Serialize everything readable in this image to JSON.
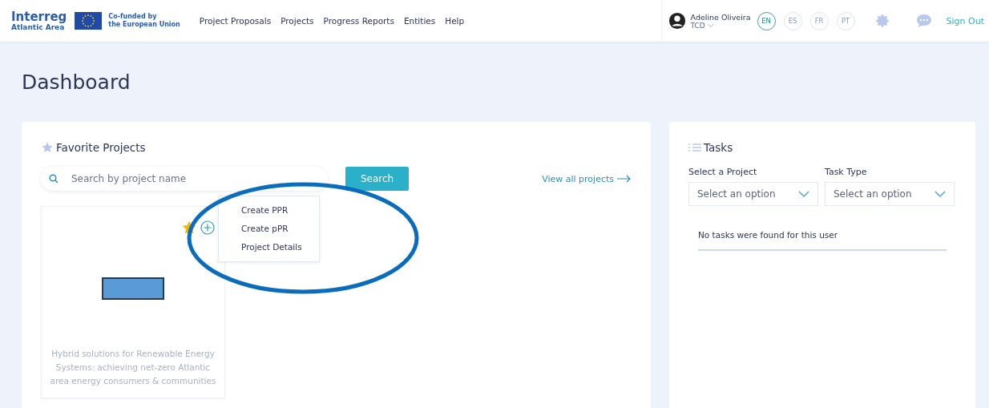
{
  "header": {
    "logo": {
      "line1": "Interreg",
      "line2": "Atlantic Area"
    },
    "eu": {
      "line1": "Co-funded by",
      "line2": "the European Union"
    },
    "nav": [
      {
        "label": "Project Proposals"
      },
      {
        "label": "Projects"
      },
      {
        "label": "Progress Reports"
      },
      {
        "label": "Entities"
      },
      {
        "label": "Help"
      }
    ],
    "user": {
      "name": "Adeline Oliveira",
      "org": "TCD"
    },
    "languages": [
      {
        "code": "EN",
        "selected": true
      },
      {
        "code": "ES",
        "selected": false
      },
      {
        "code": "FR",
        "selected": false
      },
      {
        "code": "PT",
        "selected": false
      }
    ],
    "sign_out": "Sign Out"
  },
  "page_title": "Dashboard",
  "favorites": {
    "title": "Favorite Projects",
    "search": {
      "placeholder": "Search by project name",
      "button": "Search"
    },
    "view_all": "View all projects",
    "projects": [
      {
        "title": "Hybrid solutions for Renewable Energy Systems: achieving net-zero Atlantic area energy consumers & communities",
        "favorite": true,
        "menu": [
          "Create PPR",
          "Create pPR",
          "Project Details"
        ]
      }
    ]
  },
  "tasks": {
    "title": "Tasks",
    "filters": [
      {
        "label": "Select a Project",
        "placeholder": "Select an option"
      },
      {
        "label": "Task Type",
        "placeholder": "Select an option"
      }
    ],
    "empty": "No tasks were found for this user"
  }
}
